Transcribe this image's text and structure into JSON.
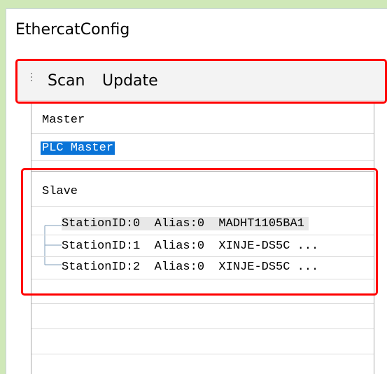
{
  "window": {
    "title": "EthercatConfig"
  },
  "toolbar": {
    "scan_label": "Scan",
    "update_label": "Update"
  },
  "tree": {
    "master_header": "Master",
    "master_item": "PLC Master",
    "slave_header": "Slave",
    "slaves": [
      {
        "text": "StationID:0  Alias:0  MADHT1105BA1"
      },
      {
        "text": "StationID:1  Alias:0  XINJE-DS5C ..."
      },
      {
        "text": "StationID:2  Alias:0  XINJE-DS5C ..."
      }
    ]
  },
  "colors": {
    "highlight_box": "#ff0000",
    "selection": "#0a74d8",
    "background_accent": "#cfe8b8"
  }
}
